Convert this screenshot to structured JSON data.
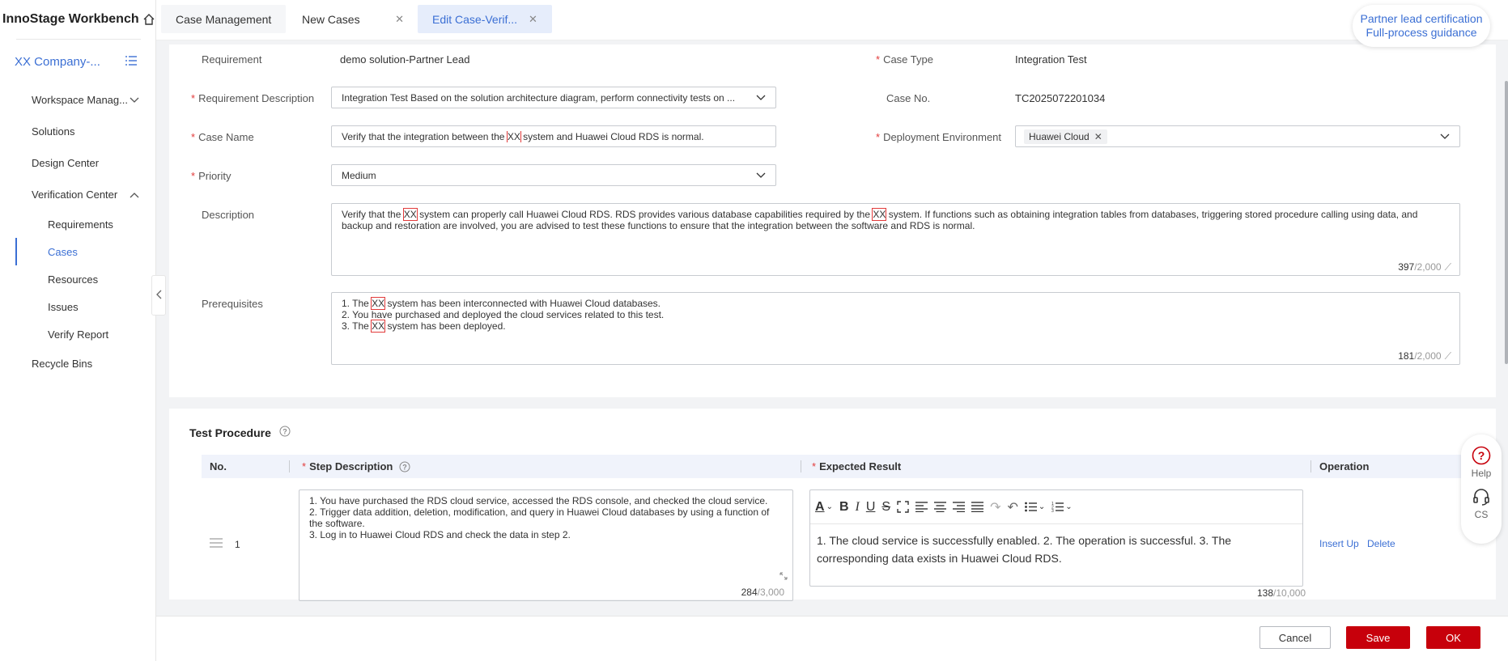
{
  "app": {
    "title": "InnoStage Workbench"
  },
  "sidebar": {
    "company": "XX Company-...",
    "items": [
      {
        "label": "Workspace Manag..."
      },
      {
        "label": "Solutions"
      },
      {
        "label": "Design Center"
      },
      {
        "label": "Verification Center"
      },
      {
        "label": "Recycle Bins"
      }
    ],
    "subitems": [
      {
        "label": "Requirements"
      },
      {
        "label": "Cases"
      },
      {
        "label": "Resources"
      },
      {
        "label": "Issues"
      },
      {
        "label": "Verify Report"
      }
    ],
    "active": "Cases"
  },
  "tabs": [
    {
      "label": "Case Management"
    },
    {
      "label": "New Cases"
    },
    {
      "label": "Edit Case-Verif..."
    }
  ],
  "partner": {
    "line1": "Partner lead certification",
    "line2": "Full-process guidance"
  },
  "form": {
    "requirement_label": "Requirement",
    "requirement_value": "demo solution-Partner Lead",
    "case_type_label": "Case Type",
    "case_type_value": "Integration Test",
    "req_desc_label": "Requirement Description",
    "req_desc_value": "Integration Test  Based on the solution architecture diagram, perform connectivity tests on ...",
    "case_no_label": "Case No.",
    "case_no_value": "TC2025072201034",
    "case_name_label": "Case Name",
    "case_name_pre": "Verify that the integration between the ",
    "case_name_hl": "XX",
    "case_name_post": " system and Huawei Cloud RDS is normal.",
    "deploy_label": "Deployment Environment",
    "deploy_tag": "Huawei Cloud",
    "priority_label": "Priority",
    "priority_value": "Medium",
    "description_label": "Description",
    "description": {
      "p1": "Verify that the ",
      "hl1": "XX",
      "p2": " system can properly call Huawei Cloud RDS. RDS provides various database capabilities required by the ",
      "hl2": "XX",
      "p3": " system. If functions such as obtaining integration tables from databases, triggering stored procedure calling using data, and backup and restoration are involved, you are advised to test these functions to ensure that the integration between the software and RDS is normal."
    },
    "description_count": "397",
    "description_max": "/2,000",
    "prereq_label": "Prerequisites",
    "prereq": {
      "l1a": "1. The ",
      "l1hl": "XX",
      "l1b": " system has been interconnected with Huawei Cloud databases.",
      "l2": "2. You have purchased and deployed the cloud services related to this test.",
      "l3a": "3. The ",
      "l3hl": "XX",
      "l3b": " system has been deployed."
    },
    "prereq_count": "181",
    "prereq_max": "/2,000"
  },
  "procedure": {
    "title": "Test Procedure",
    "columns": {
      "no": "No.",
      "step": "Step Description",
      "expected": "Expected Result",
      "operation": "Operation"
    },
    "row": {
      "no": "1",
      "step_l1": "1. You have purchased the RDS cloud service, accessed the RDS console, and checked the cloud service.",
      "step_l2": "2. Trigger data addition, deletion, modification, and query in Huawei Cloud databases by using a function of the software.",
      "step_l3": "3. Log in to Huawei Cloud RDS and check the data in step 2.",
      "step_count": "284",
      "step_max": "/3,000",
      "expected": "1. The cloud service is successfully enabled. 2. The operation is successful. 3. The corresponding data exists in Huawei Cloud RDS.",
      "expected_count": "138",
      "expected_max": "/10,000",
      "op_insert": "Insert Up",
      "op_delete": "Delete"
    }
  },
  "float_help": {
    "help": "Help",
    "cs": "CS"
  },
  "footer": {
    "cancel": "Cancel",
    "save": "Save",
    "ok": "OK"
  },
  "colors": {
    "accent": "#3b6fd4",
    "primary_button": "#c7000b",
    "required": "#e23b3b"
  }
}
